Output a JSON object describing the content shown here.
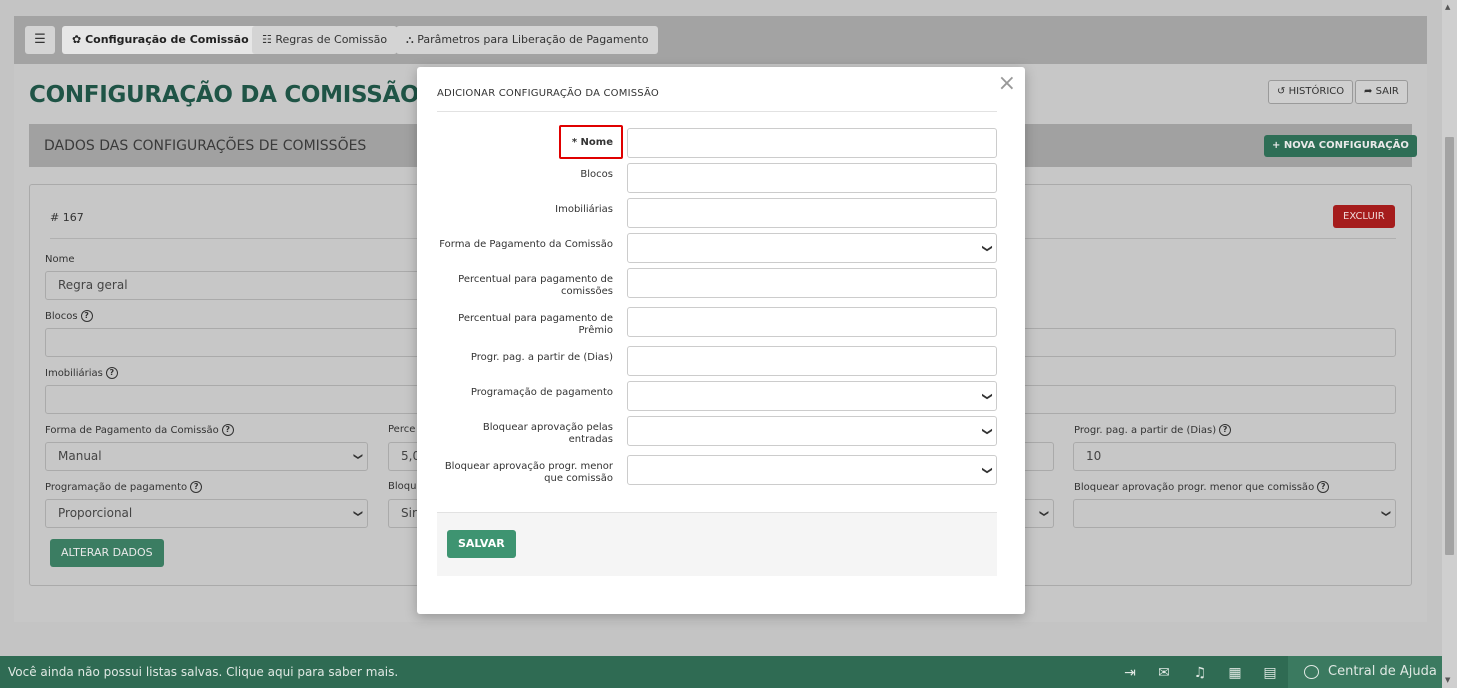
{
  "tabs": {
    "menu_icon": "☰",
    "config": "Configuração de Comissão",
    "rules": "Regras de Comissão",
    "params": "Parâmetros para Liberação de Pagamento"
  },
  "page": {
    "title": "CONFIGURAÇÃO DA COMISSÃO",
    "history_label": "HISTÓRICO",
    "exit_label": "SAIR",
    "section_title": "DADOS DAS CONFIGURAÇÕES DE COMISSÕES",
    "new_config_label": "+ NOVA CONFIGURAÇÃO"
  },
  "card": {
    "id": "# 167",
    "delete_label": "EXCLUIR",
    "fields": {
      "nome_label": "Nome",
      "nome_value": "Regra geral",
      "blocos_label": "Blocos",
      "imobiliarias_label": "Imobiliárias",
      "forma_label": "Forma de Pagamento da Comissão",
      "forma_value": "Manual",
      "percent_label_partial": "Perce",
      "percent_value_partial": "5,0",
      "progr_dias_label": "Progr. pag. a partir de (Dias)",
      "progr_dias_value": "10",
      "programacao_label": "Programação de pagamento",
      "programacao_value": "Proporcional",
      "bloq_label_partial": "Bloqu",
      "bloq_value_partial": "Sir",
      "bloq_menor_label": "Bloquear aprovação progr. menor que comissão"
    },
    "alter_label": "ALTERAR DADOS"
  },
  "modal": {
    "title": "ADICIONAR CONFIGURAÇÃO DA COMISSÃO",
    "close_icon": "×",
    "fields": [
      {
        "label": "* Nome"
      },
      {
        "label": "Blocos"
      },
      {
        "label": "Imobiliárias"
      },
      {
        "label": "Forma de Pagamento da Comissão"
      },
      {
        "label": "Percentual para pagamento de comissões"
      },
      {
        "label": "Percentual para pagamento de Prêmio"
      },
      {
        "label": "Progr. pag. a partir de (Dias)"
      },
      {
        "label": "Programação de pagamento"
      },
      {
        "label": "Bloquear aprovação pelas entradas"
      },
      {
        "label": "Bloquear aprovação progr. menor que comissão"
      }
    ],
    "save_label": "SALVAR"
  },
  "footer": {
    "message": "Você ainda não possui listas salvas. Clique aqui para saber mais.",
    "help_center": "Central de Ajuda"
  },
  "colors": {
    "brand_green": "#2f6b53",
    "title_green": "#1f5446",
    "danger_red": "#a51c1c",
    "highlight_red": "#e00000"
  }
}
